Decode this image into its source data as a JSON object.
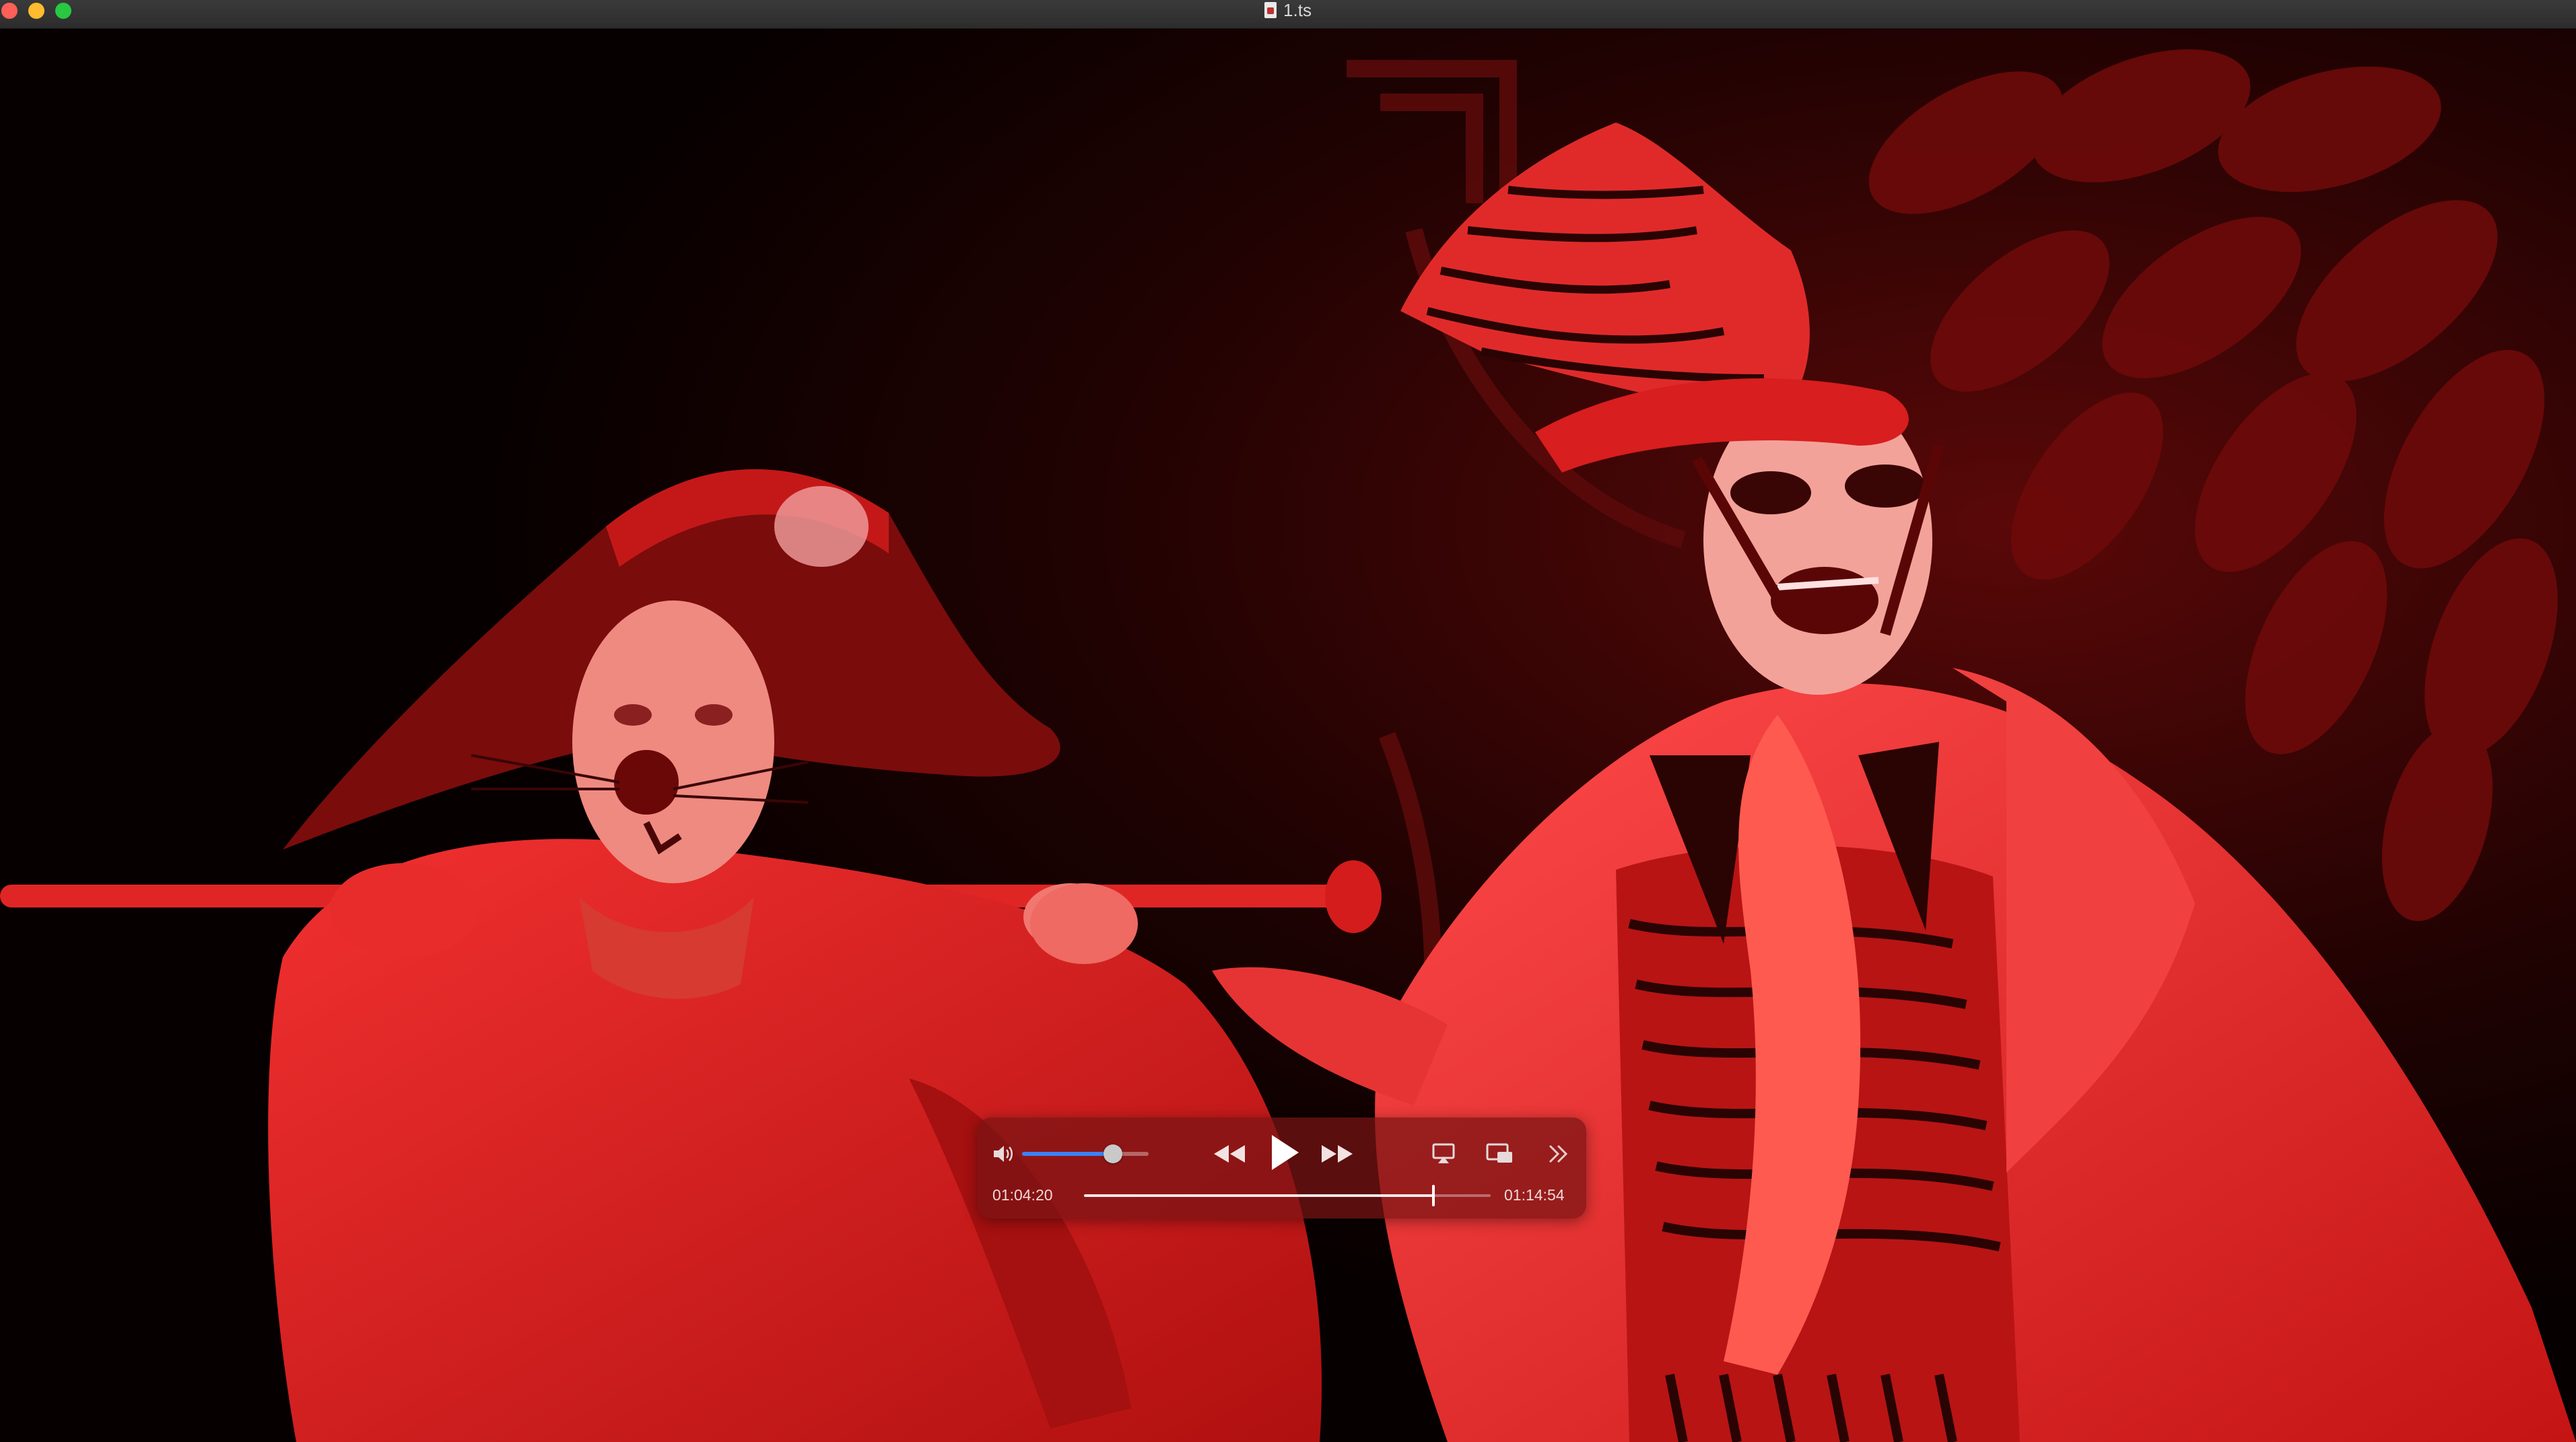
{
  "window": {
    "title": "1.ts",
    "title_icon": "video-document-icon"
  },
  "video": {
    "description_icons": [
      "video-frame"
    ],
    "dominant_color": "#e02020"
  },
  "controls": {
    "elapsed": "01:04:20",
    "total": "01:14:54",
    "progress_fraction": 0.859,
    "volume_fraction": 0.72,
    "icons": {
      "volume": "speaker-icon",
      "rewind": "rewind-icon",
      "play": "play-icon",
      "fast_forward": "fast-forward-icon",
      "airplay": "airplay-icon",
      "pip": "picture-in-picture-icon",
      "more": "chevron-double-right-icon"
    },
    "accent": "#3b82f6"
  }
}
